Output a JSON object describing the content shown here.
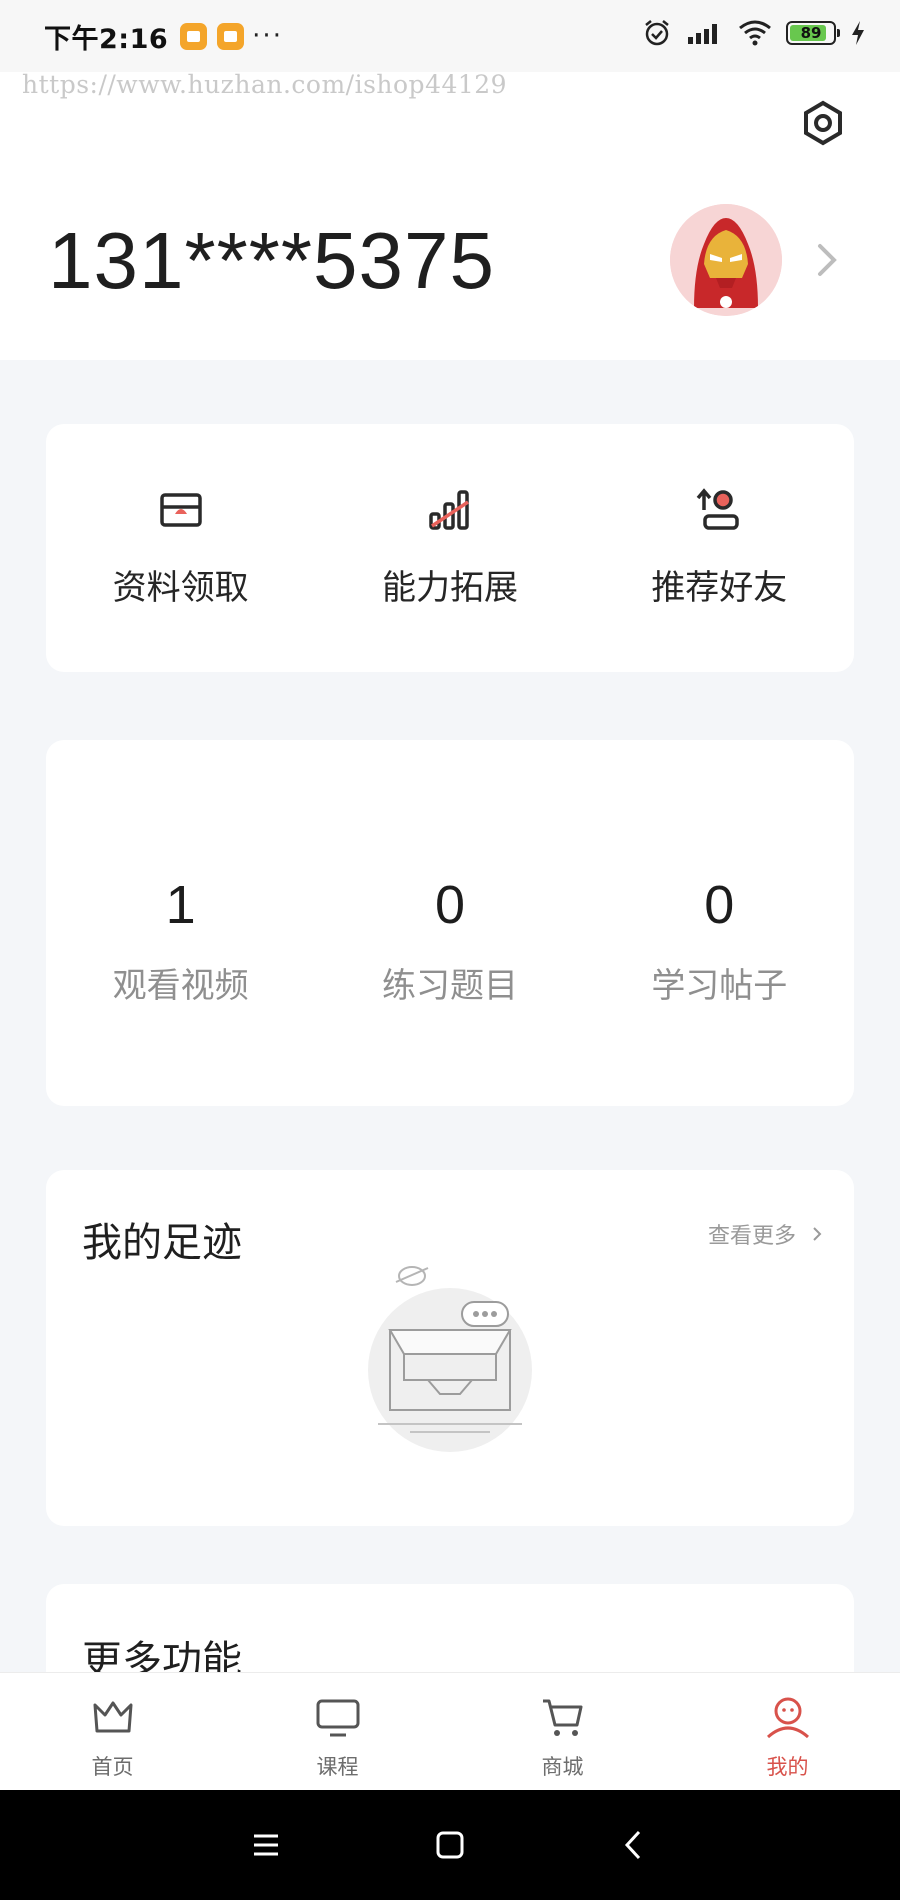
{
  "status_bar": {
    "time": "下午2:16",
    "dots": "···",
    "battery": "89"
  },
  "watermark": "https://www.huzhan.com/ishop44129",
  "header": {
    "phone": "131****5375"
  },
  "quick_actions": [
    {
      "label": "资料领取",
      "icon": "briefcase-icon"
    },
    {
      "label": "能力拓展",
      "icon": "bar-chart-icon"
    },
    {
      "label": "推荐好友",
      "icon": "person-share-icon"
    }
  ],
  "stats": [
    {
      "value": "1",
      "label": "观看视频"
    },
    {
      "value": "0",
      "label": "练习题目"
    },
    {
      "value": "0",
      "label": "学习帖子"
    }
  ],
  "footprints": {
    "title": "我的足迹",
    "view_more": "查看更多"
  },
  "more_features": {
    "title": "更多功能"
  },
  "tabs": [
    {
      "label": "首页",
      "icon": "crown-icon"
    },
    {
      "label": "课程",
      "icon": "monitor-icon"
    },
    {
      "label": "商城",
      "icon": "cart-icon"
    },
    {
      "label": "我的",
      "icon": "user-icon",
      "active": true
    }
  ],
  "colors": {
    "accent": "#d8524b",
    "background": "#f4f6f9"
  }
}
